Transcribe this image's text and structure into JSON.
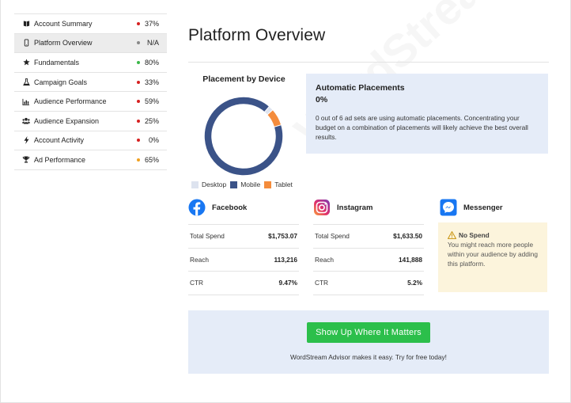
{
  "sidebar": {
    "items": [
      {
        "label": "Account Summary",
        "pct": "37%",
        "status_color": "#d62020",
        "icon": "book-icon",
        "active": false
      },
      {
        "label": "Platform Overview",
        "pct": "N/A",
        "status_color": "#888888",
        "icon": "mobile-icon",
        "active": true
      },
      {
        "label": "Fundamentals",
        "pct": "80%",
        "status_color": "#3cb84a",
        "icon": "star-icon",
        "active": false
      },
      {
        "label": "Campaign Goals",
        "pct": "33%",
        "status_color": "#d62020",
        "icon": "flask-icon",
        "active": false
      },
      {
        "label": "Audience Performance",
        "pct": "59%",
        "status_color": "#d62020",
        "icon": "bar-chart-icon",
        "active": false
      },
      {
        "label": "Audience Expansion",
        "pct": "25%",
        "status_color": "#d62020",
        "icon": "users-icon",
        "active": false
      },
      {
        "label": "Account Activity",
        "pct": "0%",
        "status_color": "#d62020",
        "icon": "bolt-icon",
        "active": false
      },
      {
        "label": "Ad Performance",
        "pct": "65%",
        "status_color": "#f0a020",
        "icon": "trophy-icon",
        "active": false
      }
    ]
  },
  "main": {
    "title": "Platform Overview",
    "placement": {
      "title": "Placement by Device",
      "legend": [
        {
          "label": "Desktop",
          "color": "#dde3ef"
        },
        {
          "label": "Mobile",
          "color": "#3b5388"
        },
        {
          "label": "Tablet",
          "color": "#f48c3c"
        }
      ]
    },
    "auto": {
      "title": "Automatic Placements",
      "pct": "0%",
      "text": "0 out of 6 ad sets are using automatic placements. Concentrating your budget on a combination of placements will likely achieve the best overall results."
    },
    "platforms": [
      {
        "name": "Facebook",
        "icon": "facebook-icon",
        "rows": [
          {
            "label": "Total Spend",
            "value": "$1,753.07"
          },
          {
            "label": "Reach",
            "value": "113,216"
          },
          {
            "label": "CTR",
            "value": "9.47%"
          }
        ]
      },
      {
        "name": "Instagram",
        "icon": "instagram-icon",
        "rows": [
          {
            "label": "Total Spend",
            "value": "$1,633.50"
          },
          {
            "label": "Reach",
            "value": "141,888"
          },
          {
            "label": "CTR",
            "value": "5.2%"
          }
        ]
      },
      {
        "name": "Messenger",
        "icon": "messenger-icon"
      }
    ],
    "no_spend": {
      "title": "No Spend",
      "text": "You might reach more people within your audience by adding this platform."
    },
    "cta": {
      "button": "Show Up Where It Matters",
      "text": "WordStream Advisor makes it easy. Try for free today!"
    },
    "watermark": "WordStream"
  },
  "chart_data": {
    "type": "pie",
    "title": "Placement by Device",
    "categories": [
      "Desktop",
      "Mobile",
      "Tablet"
    ],
    "values": [
      2,
      91,
      7
    ],
    "colors": [
      "#dde3ef",
      "#3b5388",
      "#f48c3c"
    ],
    "legend": "bottom"
  }
}
